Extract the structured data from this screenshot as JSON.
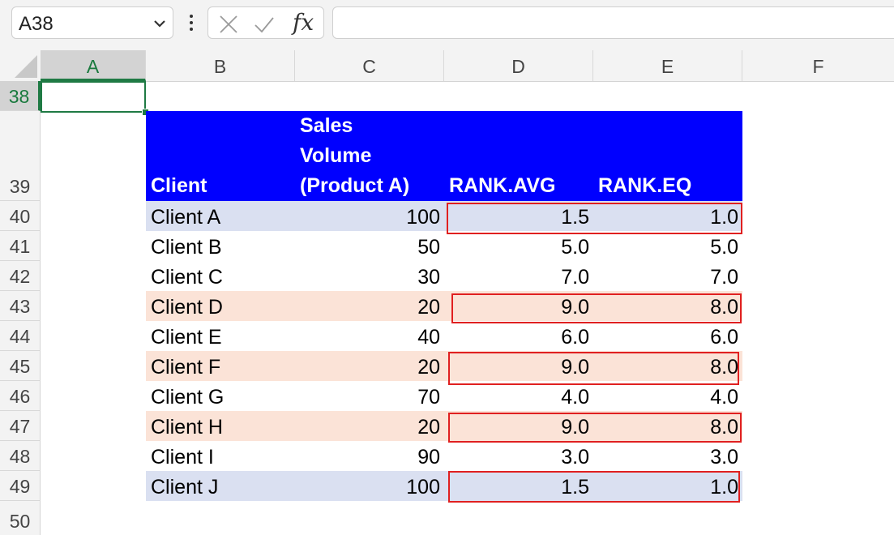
{
  "formula_bar": {
    "name_box": "A38",
    "fx_label": "fx",
    "formula": ""
  },
  "columns": [
    "A",
    "B",
    "C",
    "D",
    "E",
    "F"
  ],
  "rows": [
    "38",
    "39",
    "40",
    "41",
    "42",
    "43",
    "44",
    "45",
    "46",
    "47",
    "48",
    "49",
    "50"
  ],
  "table": {
    "headers": {
      "client": "Client",
      "sales_line1": "Sales",
      "sales_line2": "Volume",
      "sales_line3": "(Product A)",
      "rank_avg": "RANK.AVG",
      "rank_eq": "RANK.EQ"
    },
    "data": [
      {
        "client": "Client A",
        "sales": "100",
        "rank_avg": "1.5",
        "rank_eq": "1.0",
        "fill": "#dae0f1"
      },
      {
        "client": "Client B",
        "sales": "50",
        "rank_avg": "5.0",
        "rank_eq": "5.0",
        "fill": "#ffffff"
      },
      {
        "client": "Client C",
        "sales": "30",
        "rank_avg": "7.0",
        "rank_eq": "7.0",
        "fill": "#ffffff"
      },
      {
        "client": "Client D",
        "sales": "20",
        "rank_avg": "9.0",
        "rank_eq": "8.0",
        "fill": "#fbe3d7"
      },
      {
        "client": "Client E",
        "sales": "40",
        "rank_avg": "6.0",
        "rank_eq": "6.0",
        "fill": "#ffffff"
      },
      {
        "client": "Client F",
        "sales": "20",
        "rank_avg": "9.0",
        "rank_eq": "8.0",
        "fill": "#fbe3d7"
      },
      {
        "client": "Client G",
        "sales": "70",
        "rank_avg": "4.0",
        "rank_eq": "4.0",
        "fill": "#ffffff"
      },
      {
        "client": "Client H",
        "sales": "20",
        "rank_avg": "9.0",
        "rank_eq": "8.0",
        "fill": "#fbe3d7"
      },
      {
        "client": "Client I",
        "sales": "90",
        "rank_avg": "3.0",
        "rank_eq": "3.0",
        "fill": "#ffffff"
      },
      {
        "client": "Client J",
        "sales": "100",
        "rank_avg": "1.5",
        "rank_eq": "1.0",
        "fill": "#dae0f1"
      }
    ],
    "highlighted_rows": [
      "40",
      "43",
      "45",
      "47",
      "49"
    ]
  },
  "colors": {
    "header_fill": "#0000ff",
    "highlight_border": "#e02020",
    "selection": "#1f7a44"
  }
}
